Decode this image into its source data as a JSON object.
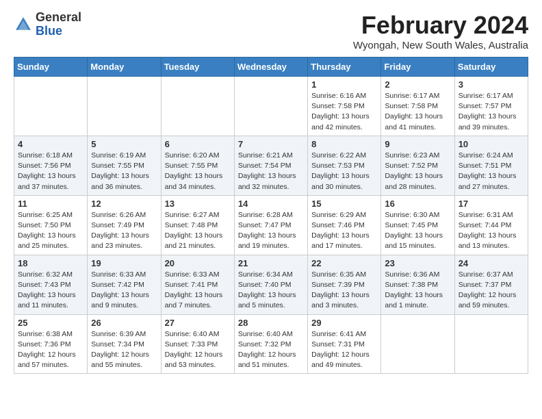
{
  "logo": {
    "general": "General",
    "blue": "Blue"
  },
  "title": "February 2024",
  "location": "Wyongah, New South Wales, Australia",
  "days_of_week": [
    "Sunday",
    "Monday",
    "Tuesday",
    "Wednesday",
    "Thursday",
    "Friday",
    "Saturday"
  ],
  "weeks": [
    [
      {
        "day": "",
        "info": ""
      },
      {
        "day": "",
        "info": ""
      },
      {
        "day": "",
        "info": ""
      },
      {
        "day": "",
        "info": ""
      },
      {
        "day": "1",
        "info": "Sunrise: 6:16 AM\nSunset: 7:58 PM\nDaylight: 13 hours\nand 42 minutes."
      },
      {
        "day": "2",
        "info": "Sunrise: 6:17 AM\nSunset: 7:58 PM\nDaylight: 13 hours\nand 41 minutes."
      },
      {
        "day": "3",
        "info": "Sunrise: 6:17 AM\nSunset: 7:57 PM\nDaylight: 13 hours\nand 39 minutes."
      }
    ],
    [
      {
        "day": "4",
        "info": "Sunrise: 6:18 AM\nSunset: 7:56 PM\nDaylight: 13 hours\nand 37 minutes."
      },
      {
        "day": "5",
        "info": "Sunrise: 6:19 AM\nSunset: 7:55 PM\nDaylight: 13 hours\nand 36 minutes."
      },
      {
        "day": "6",
        "info": "Sunrise: 6:20 AM\nSunset: 7:55 PM\nDaylight: 13 hours\nand 34 minutes."
      },
      {
        "day": "7",
        "info": "Sunrise: 6:21 AM\nSunset: 7:54 PM\nDaylight: 13 hours\nand 32 minutes."
      },
      {
        "day": "8",
        "info": "Sunrise: 6:22 AM\nSunset: 7:53 PM\nDaylight: 13 hours\nand 30 minutes."
      },
      {
        "day": "9",
        "info": "Sunrise: 6:23 AM\nSunset: 7:52 PM\nDaylight: 13 hours\nand 28 minutes."
      },
      {
        "day": "10",
        "info": "Sunrise: 6:24 AM\nSunset: 7:51 PM\nDaylight: 13 hours\nand 27 minutes."
      }
    ],
    [
      {
        "day": "11",
        "info": "Sunrise: 6:25 AM\nSunset: 7:50 PM\nDaylight: 13 hours\nand 25 minutes."
      },
      {
        "day": "12",
        "info": "Sunrise: 6:26 AM\nSunset: 7:49 PM\nDaylight: 13 hours\nand 23 minutes."
      },
      {
        "day": "13",
        "info": "Sunrise: 6:27 AM\nSunset: 7:48 PM\nDaylight: 13 hours\nand 21 minutes."
      },
      {
        "day": "14",
        "info": "Sunrise: 6:28 AM\nSunset: 7:47 PM\nDaylight: 13 hours\nand 19 minutes."
      },
      {
        "day": "15",
        "info": "Sunrise: 6:29 AM\nSunset: 7:46 PM\nDaylight: 13 hours\nand 17 minutes."
      },
      {
        "day": "16",
        "info": "Sunrise: 6:30 AM\nSunset: 7:45 PM\nDaylight: 13 hours\nand 15 minutes."
      },
      {
        "day": "17",
        "info": "Sunrise: 6:31 AM\nSunset: 7:44 PM\nDaylight: 13 hours\nand 13 minutes."
      }
    ],
    [
      {
        "day": "18",
        "info": "Sunrise: 6:32 AM\nSunset: 7:43 PM\nDaylight: 13 hours\nand 11 minutes."
      },
      {
        "day": "19",
        "info": "Sunrise: 6:33 AM\nSunset: 7:42 PM\nDaylight: 13 hours\nand 9 minutes."
      },
      {
        "day": "20",
        "info": "Sunrise: 6:33 AM\nSunset: 7:41 PM\nDaylight: 13 hours\nand 7 minutes."
      },
      {
        "day": "21",
        "info": "Sunrise: 6:34 AM\nSunset: 7:40 PM\nDaylight: 13 hours\nand 5 minutes."
      },
      {
        "day": "22",
        "info": "Sunrise: 6:35 AM\nSunset: 7:39 PM\nDaylight: 13 hours\nand 3 minutes."
      },
      {
        "day": "23",
        "info": "Sunrise: 6:36 AM\nSunset: 7:38 PM\nDaylight: 13 hours\nand 1 minute."
      },
      {
        "day": "24",
        "info": "Sunrise: 6:37 AM\nSunset: 7:37 PM\nDaylight: 12 hours\nand 59 minutes."
      }
    ],
    [
      {
        "day": "25",
        "info": "Sunrise: 6:38 AM\nSunset: 7:36 PM\nDaylight: 12 hours\nand 57 minutes."
      },
      {
        "day": "26",
        "info": "Sunrise: 6:39 AM\nSunset: 7:34 PM\nDaylight: 12 hours\nand 55 minutes."
      },
      {
        "day": "27",
        "info": "Sunrise: 6:40 AM\nSunset: 7:33 PM\nDaylight: 12 hours\nand 53 minutes."
      },
      {
        "day": "28",
        "info": "Sunrise: 6:40 AM\nSunset: 7:32 PM\nDaylight: 12 hours\nand 51 minutes."
      },
      {
        "day": "29",
        "info": "Sunrise: 6:41 AM\nSunset: 7:31 PM\nDaylight: 12 hours\nand 49 minutes."
      },
      {
        "day": "",
        "info": ""
      },
      {
        "day": "",
        "info": ""
      }
    ]
  ]
}
